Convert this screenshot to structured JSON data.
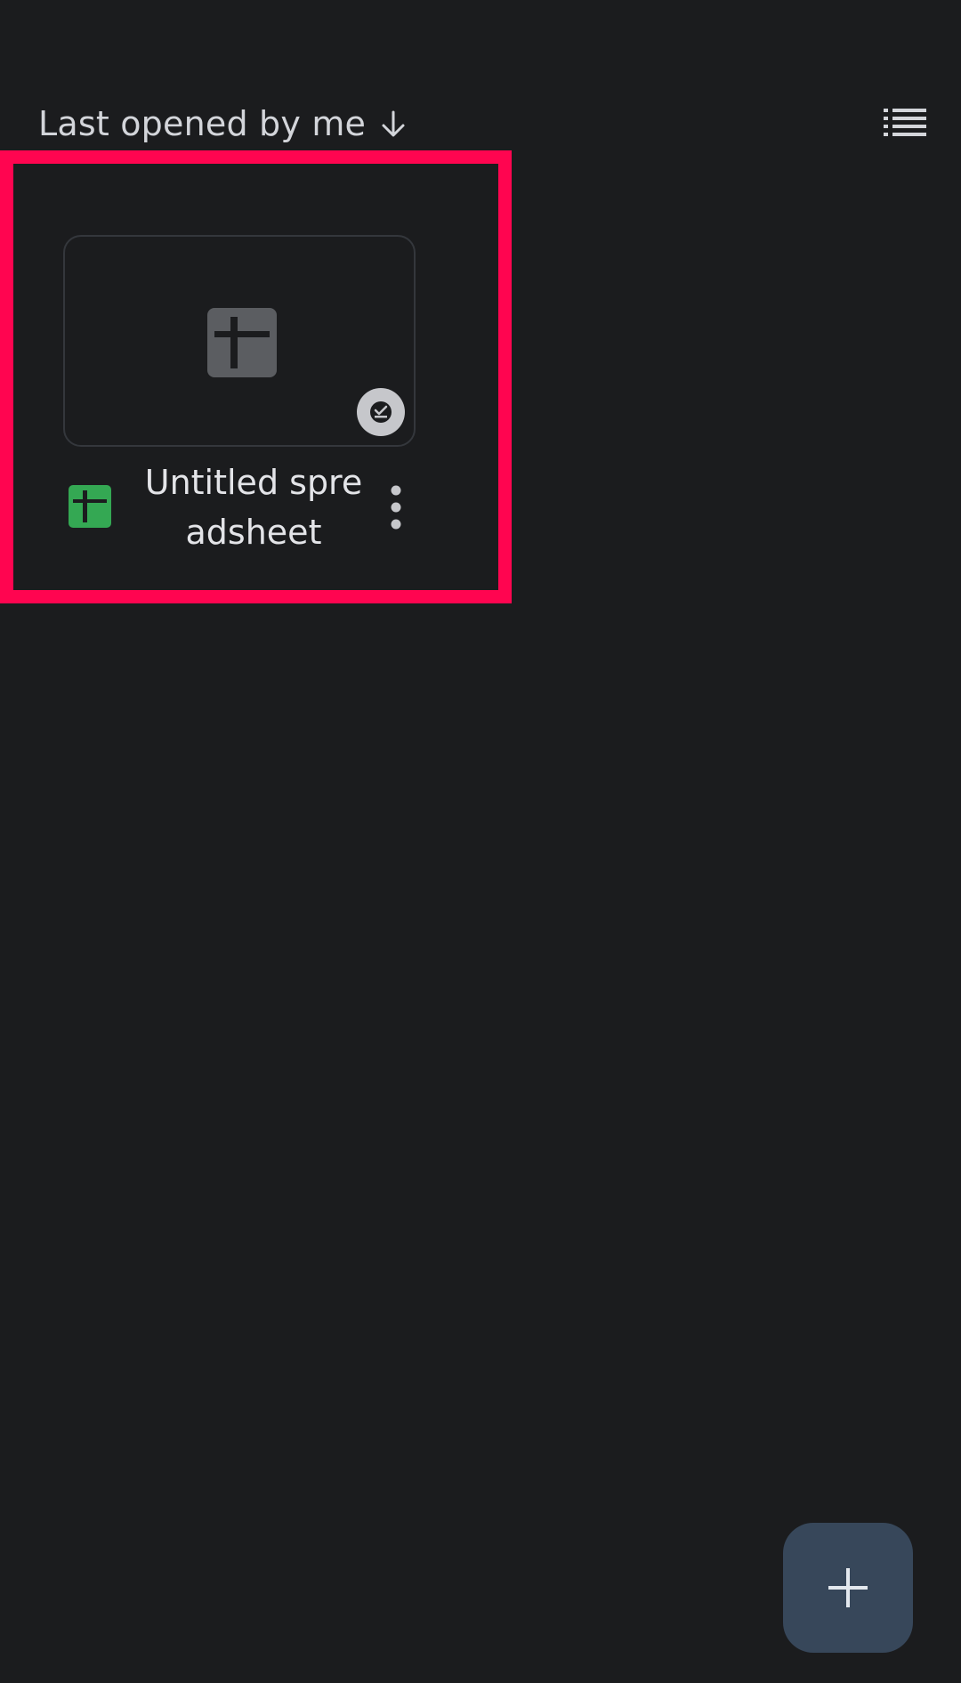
{
  "sort": {
    "label": "Last opened by me",
    "direction_icon": "arrow-down-icon"
  },
  "toolbar": {
    "view_toggle_icon": "list-view-icon"
  },
  "files": [
    {
      "title": "Untitled spreadsheet",
      "type_icon": "google-sheets-icon",
      "thumbnail_icon": "sheets-placeholder-icon",
      "badge_icon": "available-offline-icon",
      "menu_icon": "more-vert-icon"
    }
  ],
  "fab": {
    "icon": "plus-icon"
  },
  "colors": {
    "background": "#1b1c1e",
    "highlight": "#ff0550",
    "sheets_green": "#34a853",
    "fab_background": "#37475a",
    "text_primary": "#e3e4e8"
  }
}
